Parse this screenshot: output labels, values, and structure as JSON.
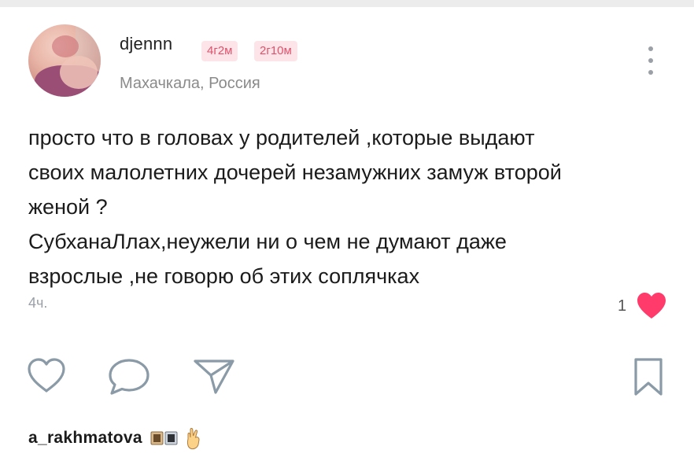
{
  "post": {
    "author": {
      "username": "djennn",
      "badges": [
        "4г2м",
        "2г10м"
      ],
      "location": "Махачкала, Россия"
    },
    "body_lines": [
      "просто что в головах у родителей ,которые выдают",
      "своих малолетних дочерей незамужних замуж второй",
      "женой ?",
      "СубханаЛлах,неужели ни о чем не думают даже",
      "взрослые ,не говорю об этих соплячках"
    ],
    "time": "4ч.",
    "likes": "1"
  },
  "actions": [
    "like-icon",
    "comment-icon",
    "share-icon",
    "bookmark-icon"
  ],
  "comment": {
    "username": "a_rakhmatova"
  },
  "colors": {
    "accent": "#ff3b6b",
    "badge_bg": "#fde4e8",
    "badge_text": "#e0526c",
    "icon": "#8a9aa6"
  }
}
